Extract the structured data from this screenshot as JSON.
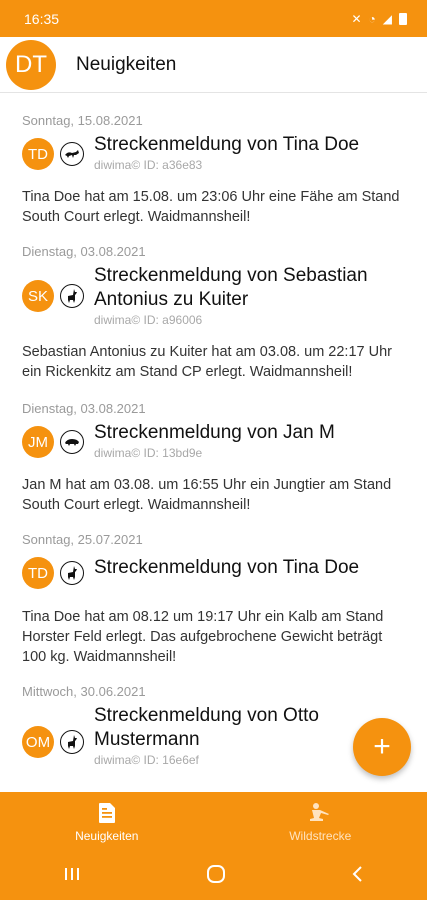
{
  "status_bar": {
    "time": "16:35"
  },
  "header": {
    "avatar_initials": "DT",
    "title": "Neuigkeiten"
  },
  "feed": [
    {
      "date": "Sonntag, 15.08.2021",
      "initials": "TD",
      "game_icon": "fox-icon",
      "title": "Streckenmeldung von Tina Doe",
      "id_text": "diwima© ID: a36e83",
      "body": "Tina Doe hat am 15.08. um 23:06 Uhr eine Fähe am Stand South Court erlegt. Waidmannsheil!"
    },
    {
      "date": "Dienstag, 03.08.2021",
      "initials": "SK",
      "game_icon": "deer-icon",
      "title": "Streckenmeldung von Sebastian Antonius zu Kuiter",
      "id_text": "diwima© ID: a96006",
      "body": "Sebastian Antonius zu Kuiter hat am 03.08. um 22:17 Uhr ein Rickenkitz am Stand CP erlegt. Waidmannsheil!"
    },
    {
      "date": "Dienstag, 03.08.2021",
      "initials": "JM",
      "game_icon": "boar-icon",
      "title": "Streckenmeldung von Jan M",
      "id_text": "diwima© ID: 13bd9e",
      "body": "Jan M hat am 03.08. um 16:55 Uhr ein Jungtier am Stand South Court erlegt. Waidmannsheil!"
    },
    {
      "date": "Sonntag, 25.07.2021",
      "initials": "TD",
      "game_icon": "deer-icon",
      "title": "Streckenmeldung von Tina Doe",
      "id_text": "",
      "body": "Tina Doe hat am 08.12 um 19:17 Uhr ein Kalb am Stand Horster Feld erlegt. Das aufgebrochene Gewicht beträgt 100 kg. Waidmannsheil!"
    },
    {
      "date": "Mittwoch, 30.06.2021",
      "initials": "OM",
      "game_icon": "deer-icon",
      "title": "Streckenmeldung von Otto Mustermann",
      "id_text": "diwima© ID: 16e6ef",
      "body": ""
    }
  ],
  "fab": {
    "label": "+"
  },
  "bottom_nav": [
    {
      "label": "Neuigkeiten",
      "icon": "news-icon",
      "active": true
    },
    {
      "label": "Wildstrecke",
      "icon": "hunter-icon",
      "active": false
    }
  ],
  "colors": {
    "accent": "#f5920f"
  }
}
